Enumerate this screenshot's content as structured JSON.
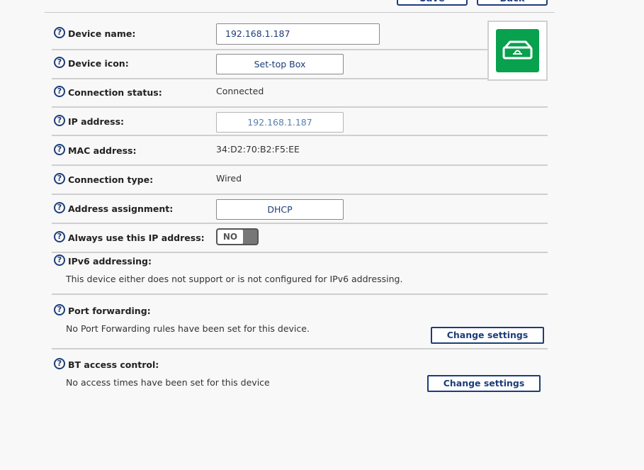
{
  "header": {
    "save_label": "Save",
    "back_label": "Back"
  },
  "device_name": {
    "label": "Device name:",
    "value": "192.168.1.187"
  },
  "device_icon": {
    "label": "Device icon:",
    "value": "Set-top Box",
    "icon": "set-top-box-icon",
    "icon_bg": "#08a14e"
  },
  "connection_status": {
    "label": "Connection status:",
    "value": "Connected"
  },
  "ip_address": {
    "label": "IP address:",
    "value": "192.168.1.187"
  },
  "mac_address": {
    "label": "MAC address:",
    "value": "34:D2:70:B2:F5:EE"
  },
  "connection_type": {
    "label": "Connection type:",
    "value": "Wired"
  },
  "address_assignment": {
    "label": "Address assignment:",
    "value": "DHCP"
  },
  "always_use_ip": {
    "label": "Always use this IP address:",
    "toggle_text": "NO"
  },
  "ipv6": {
    "label": "IPv6 addressing:",
    "description": "This device either does not support or is not configured for IPv6 addressing."
  },
  "port_forwarding": {
    "label": "Port forwarding:",
    "description": "No Port Forwarding rules have been set for this device.",
    "button_label": "Change settings"
  },
  "access_control": {
    "label": "BT access control:",
    "description": "No access times have been set for this device",
    "button_label": "Change settings"
  },
  "help_glyph": "?",
  "colors": {
    "accent": "#1d3d7a",
    "green": "#08a14e"
  }
}
